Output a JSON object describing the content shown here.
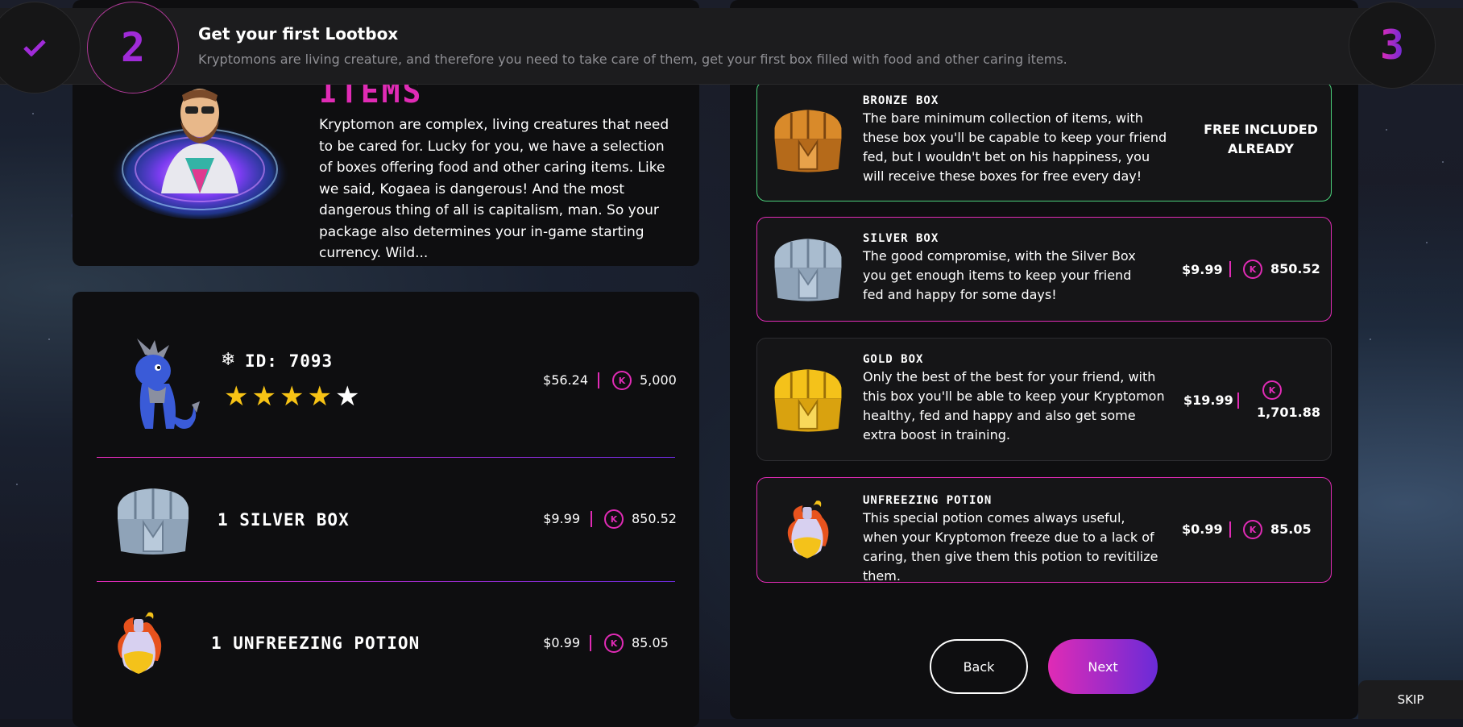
{
  "progress": {
    "done_step_icon": "check-icon",
    "current_step_number": "2",
    "next_step_number": "3",
    "title": "Get your first Lootbox",
    "subtitle": "Kryptomons are living creature, and therefore you need to take care of them, get your first box filled with food and other caring items."
  },
  "intro": {
    "heading": "ITEMS",
    "text": "Kryptomon are complex, living creatures that need to be cared for. Lucky for you, we have a selection of boxes offering food and other caring items. Like we said, Kogaea is dangerous! And the most dangerous thing of all is capitalism, man. So your package also determines your in-game starting currency. Wild..."
  },
  "summary": {
    "kryptomon": {
      "id_label": "ID: 7093",
      "element_icon": "snowflake-icon",
      "stars_filled": 4,
      "stars_total": 5,
      "price_usd": "$56.24",
      "price_kmon": "5,000"
    },
    "silver": {
      "label": "1 SILVER BOX",
      "price_usd": "$9.99",
      "price_kmon": "850.52"
    },
    "potion": {
      "label": "1 UNFREEZING POTION",
      "price_usd": "$0.99",
      "price_kmon": "85.05"
    }
  },
  "boxes": {
    "bronze": {
      "name": "BRONZE BOX",
      "desc": "The bare minimum collection of items, with these box you'll be capable to keep your friend fed, but I wouldn't bet on his happiness, you will receive these boxes for free every day!",
      "status": "FREE INCLUDED ALREADY"
    },
    "silver": {
      "name": "SILVER BOX",
      "desc": "The good compromise, with the Silver Box you get enough items to keep your friend fed and happy for some days!",
      "price_usd": "$9.99",
      "price_kmon": "850.52"
    },
    "gold": {
      "name": "GOLD BOX",
      "desc": "Only the best of the best for your friend, with this box you'll be able to keep your Kryptomon healthy, fed and happy and also get some extra boost in training.",
      "price_usd": "$19.99",
      "price_kmon": "1,701.88"
    },
    "potion": {
      "name": "UNFREEZING POTION",
      "desc": "This special potion comes always useful, when your Kryptomon freeze due to a lack of caring, then give them this potion to revitilize them.",
      "price_usd": "$0.99",
      "price_kmon": "85.05"
    }
  },
  "buttons": {
    "back": "Back",
    "next": "Next",
    "skip": "SKIP"
  },
  "colors": {
    "accent_pink": "#e02bb5",
    "accent_purple": "#6a2bd8",
    "selected_green": "#4ad07a",
    "star_yellow": "#f7c315"
  }
}
